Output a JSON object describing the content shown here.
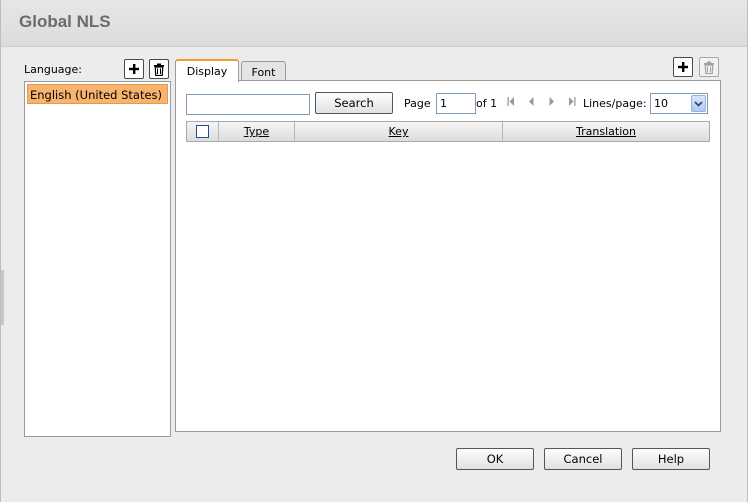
{
  "dialog": {
    "title": "Global NLS"
  },
  "language": {
    "label": "Language:",
    "items": [
      "English (United States)"
    ]
  },
  "tabs": [
    {
      "label": "Display",
      "active": true
    },
    {
      "label": "Font",
      "active": false
    }
  ],
  "toolbar": {
    "search_label": "Search",
    "search_value": "",
    "page_label": "Page",
    "page_value": "1",
    "of_label": "of 1",
    "lines_label": "Lines/page:",
    "lines_value": "10"
  },
  "grid": {
    "columns": [
      "Type",
      "Key",
      "Translation"
    ],
    "rows": []
  },
  "footer": {
    "ok_label": "OK",
    "cancel_label": "Cancel",
    "help_label": "Help"
  },
  "icons": {
    "add": "plus-icon",
    "delete": "trash-icon",
    "first": "first-page-icon",
    "prev": "prev-page-icon",
    "next": "next-page-icon",
    "last": "last-page-icon",
    "dropdown": "chevron-down-icon"
  },
  "colors": {
    "selection": "#f8b46e",
    "tab_accent": "#f0a030",
    "title_text": "#6b6b6b"
  }
}
